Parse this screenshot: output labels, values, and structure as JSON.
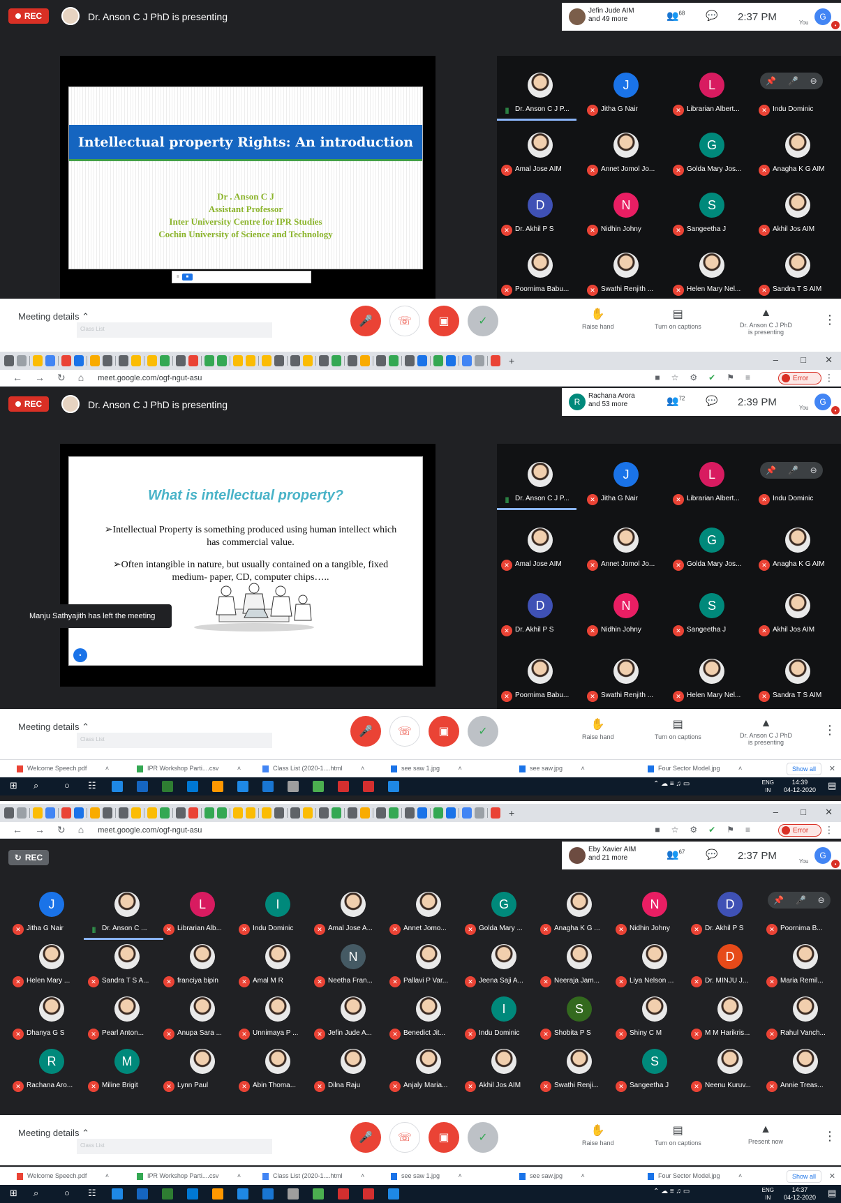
{
  "panel1": {
    "rec_label": "REC",
    "presenting_text": "Dr. Anson C J PhD is presenting",
    "joiner_line1": "Jefin Jude AIM",
    "joiner_line2": "and 49 more",
    "people_count": "68",
    "time": "2:37 PM",
    "you_label": "You",
    "user_initial": "G",
    "slide": {
      "title": "Intellectual property Rights: An introduction",
      "author_lines": [
        "Dr . Anson C J",
        "Assistant Professor",
        "Inter University Centre for IPR Studies",
        "Cochin University of Science and Technology"
      ]
    },
    "participants": [
      {
        "name": "Dr. Anson C J P...",
        "initial": "",
        "color": "",
        "speaking": true
      },
      {
        "name": "Jitha G Nair",
        "initial": "J",
        "color": "#1a73e8"
      },
      {
        "name": "Librarian Albert...",
        "initial": "L",
        "color": "#d81b60"
      },
      {
        "name": "Indu Dominic",
        "initial": "",
        "color": "",
        "pin": true
      },
      {
        "name": "Amal Jose AIM",
        "initial": "",
        "color": ""
      },
      {
        "name": "Annet Jomol Jo...",
        "initial": "",
        "color": ""
      },
      {
        "name": "Golda Mary Jos...",
        "initial": "G",
        "color": "#00897b"
      },
      {
        "name": "Anagha K G AIM",
        "initial": "",
        "color": ""
      },
      {
        "name": "Dr. Akhil P S",
        "initial": "D",
        "color": "#3f51b5"
      },
      {
        "name": "Nidhin Johny",
        "initial": "N",
        "color": "#e91e63"
      },
      {
        "name": "Sangeetha J",
        "initial": "S",
        "color": "#00897b"
      },
      {
        "name": "Akhil Jos AIM",
        "initial": "",
        "color": ""
      },
      {
        "name": "Poornima Babu...",
        "initial": "",
        "color": ""
      },
      {
        "name": "Swathi Renjith ...",
        "initial": "",
        "color": ""
      },
      {
        "name": "Helen Mary Nel...",
        "initial": "",
        "color": ""
      },
      {
        "name": "Sandra T S AIM",
        "initial": "",
        "color": ""
      }
    ]
  },
  "panel2": {
    "url": "meet.google.com/ogf-ngut-asu",
    "error_label": "Error",
    "rec_label": "REC",
    "presenting_text": "Dr. Anson C J PhD is presenting",
    "joiner_initial": "R",
    "joiner_line1": "Rachana Arora",
    "joiner_line2": "and 53 more",
    "people_count": "72",
    "time": "2:39 PM",
    "you_label": "You",
    "user_initial": "G",
    "slide": {
      "title": "What is intellectual property?",
      "bullet1": "➢Intellectual Property is something produced using human intellect which has commercial value.",
      "bullet2": "➢Often intangible in nature, but usually contained on a tangible, fixed medium- paper, CD, computer chips….."
    },
    "toast": "Manju Sathyajith has left the meeting",
    "participants": [
      {
        "name": "Dr. Anson C J P...",
        "initial": "",
        "color": "",
        "speaking": true
      },
      {
        "name": "Jitha G Nair",
        "initial": "J",
        "color": "#1a73e8"
      },
      {
        "name": "Librarian Albert...",
        "initial": "L",
        "color": "#d81b60"
      },
      {
        "name": "Indu Dominic",
        "initial": "",
        "color": "",
        "pin": true
      },
      {
        "name": "Amal Jose AIM",
        "initial": "",
        "color": ""
      },
      {
        "name": "Annet Jomol Jo...",
        "initial": "",
        "color": ""
      },
      {
        "name": "Golda Mary Jos...",
        "initial": "G",
        "color": "#00897b"
      },
      {
        "name": "Anagha K G AIM",
        "initial": "",
        "color": ""
      },
      {
        "name": "Dr. Akhil P S",
        "initial": "D",
        "color": "#3f51b5"
      },
      {
        "name": "Nidhin Johny",
        "initial": "N",
        "color": "#e91e63"
      },
      {
        "name": "Sangeetha J",
        "initial": "S",
        "color": "#00897b"
      },
      {
        "name": "Akhil Jos AIM",
        "initial": "",
        "color": ""
      },
      {
        "name": "Poornima Babu...",
        "initial": "",
        "color": ""
      },
      {
        "name": "Swathi Renjith ...",
        "initial": "",
        "color": ""
      },
      {
        "name": "Helen Mary Nel...",
        "initial": "",
        "color": ""
      },
      {
        "name": "Sandra T S AIM",
        "initial": "",
        "color": ""
      }
    ],
    "taskbar_date": "04-12-2020",
    "taskbar_time": "14:39"
  },
  "panel3": {
    "url": "meet.google.com/ogf-ngut-asu",
    "error_label": "Error",
    "rec_label": "REC",
    "joiner_line1": "Eby Xavier AIM",
    "joiner_line2": "and 21 more",
    "people_count": "67",
    "time": "2:37 PM",
    "you_label": "You",
    "user_initial": "G",
    "participants": [
      {
        "name": "Jitha G Nair",
        "initial": "J",
        "color": "#1a73e8"
      },
      {
        "name": "Dr. Anson C ...",
        "initial": "",
        "color": "",
        "speaking": true
      },
      {
        "name": "Librarian Alb...",
        "initial": "L",
        "color": "#d81b60"
      },
      {
        "name": "Indu Dominic",
        "initial": "I",
        "color": "#00897b"
      },
      {
        "name": "Amal Jose A...",
        "initial": "",
        "color": ""
      },
      {
        "name": "Annet Jomo...",
        "initial": "",
        "color": ""
      },
      {
        "name": "Golda Mary ...",
        "initial": "G",
        "color": "#00897b"
      },
      {
        "name": "Anagha K G ...",
        "initial": "",
        "color": ""
      },
      {
        "name": "Nidhin Johny",
        "initial": "N",
        "color": "#e91e63"
      },
      {
        "name": "Dr. Akhil P S",
        "initial": "D",
        "color": "#3f51b5"
      },
      {
        "name": "Poornima B...",
        "initial": "",
        "color": "",
        "pin": true
      },
      {
        "name": "Helen Mary ...",
        "initial": "",
        "color": ""
      },
      {
        "name": "Sandra T S A...",
        "initial": "",
        "color": ""
      },
      {
        "name": "franciya bipin",
        "initial": "",
        "color": ""
      },
      {
        "name": "Amal M R",
        "initial": "",
        "color": ""
      },
      {
        "name": "Neetha Fran...",
        "initial": "N",
        "color": "#455a64"
      },
      {
        "name": "Pallavi P Var...",
        "initial": "",
        "color": ""
      },
      {
        "name": "Jeena Saji A...",
        "initial": "",
        "color": ""
      },
      {
        "name": "Neeraja Jam...",
        "initial": "",
        "color": ""
      },
      {
        "name": "Liya Nelson ...",
        "initial": "",
        "color": ""
      },
      {
        "name": "Dr. MINJU J...",
        "initial": "D",
        "color": "#e64a19"
      },
      {
        "name": "Maria Remil...",
        "initial": "",
        "color": ""
      },
      {
        "name": "Dhanya G S",
        "initial": "",
        "color": ""
      },
      {
        "name": "Pearl Anton...",
        "initial": "",
        "color": ""
      },
      {
        "name": "Anupa Sara ...",
        "initial": "",
        "color": ""
      },
      {
        "name": "Unnimaya P ...",
        "initial": "",
        "color": ""
      },
      {
        "name": "Jefin Jude A...",
        "initial": "",
        "color": ""
      },
      {
        "name": "Benedict Jit...",
        "initial": "",
        "color": ""
      },
      {
        "name": "Indu Dominic",
        "initial": "I",
        "color": "#00897b"
      },
      {
        "name": "Shobita P S",
        "initial": "S",
        "color": "#33691e"
      },
      {
        "name": "Shiny C M",
        "initial": "",
        "color": ""
      },
      {
        "name": "M M Harikris...",
        "initial": "",
        "color": ""
      },
      {
        "name": "Rahul Vanch...",
        "initial": "",
        "color": ""
      },
      {
        "name": "Rachana Aro...",
        "initial": "R",
        "color": "#00897b"
      },
      {
        "name": "Miline Brigit",
        "initial": "M",
        "color": "#00897b"
      },
      {
        "name": "Lynn Paul",
        "initial": "",
        "color": ""
      },
      {
        "name": "Abin Thoma...",
        "initial": "",
        "color": ""
      },
      {
        "name": "Dilna Raju",
        "initial": "",
        "color": ""
      },
      {
        "name": "Anjaly Maria...",
        "initial": "",
        "color": ""
      },
      {
        "name": "Akhil Jos AIM",
        "initial": "",
        "color": ""
      },
      {
        "name": "Swathi Renji...",
        "initial": "",
        "color": ""
      },
      {
        "name": "Sangeetha J",
        "initial": "S",
        "color": "#00897b"
      },
      {
        "name": "Neenu Kuruv...",
        "initial": "",
        "color": ""
      },
      {
        "name": "Annie Treas...",
        "initial": "",
        "color": ""
      }
    ],
    "taskbar_date": "04-12-2020",
    "taskbar_time": "14:37"
  },
  "bottombar": {
    "meeting_details": "Meeting details",
    "classlist_ghost": "Class List",
    "raise_hand": "Raise hand",
    "captions": "Turn on captions",
    "presenting_line1": "Dr. Anson C J PhD",
    "presenting_line2": "is presenting",
    "present_now": "Present now"
  },
  "downloads": {
    "items": [
      "Welcome Speech.pdf",
      "IPR Workshop Parti....csv",
      "Class List (2020-1....html",
      "see saw 1.jpg",
      "see saw.jpg",
      "Four Sector Model.jpg"
    ],
    "show_all": "Show all"
  },
  "taskbar": {
    "lang_line1": "ENG",
    "lang_line2": "IN"
  }
}
